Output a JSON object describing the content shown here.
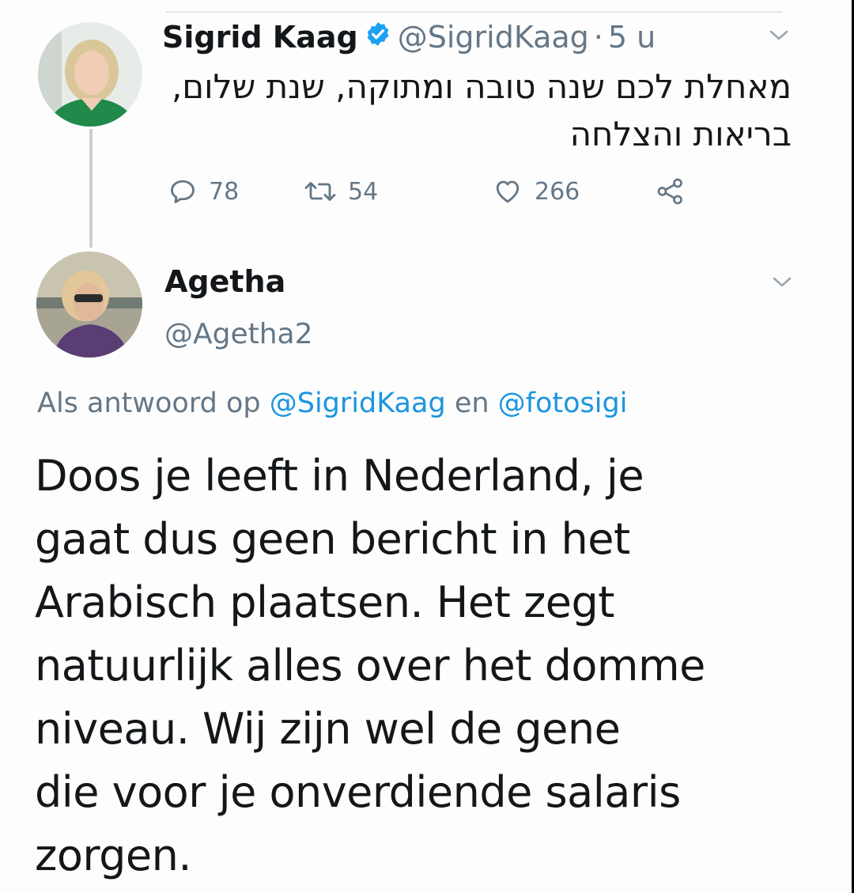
{
  "tweet1": {
    "name": "Sigrid Kaag",
    "handle": "@SigridKaag",
    "separator": "·",
    "time": "5 u",
    "text_line1": "מאחלת לכם שנה טובה ומתוקה, שנת שלום,",
    "text_line2": "בריאות והצלחה",
    "replies": "78",
    "retweets": "54",
    "likes": "266"
  },
  "tweet2": {
    "name": "Agetha",
    "handle": "@Agetha2",
    "reply_prefix": "Als antwoord op",
    "reply_user1": "@SigridKaag",
    "reply_conj": "en",
    "reply_user2": "@fotosigi",
    "lines": [
      "Doos je leeft in Nederland, je",
      "gaat dus geen bericht in het",
      "Arabisch plaatsen. Het zegt",
      "natuurlijk alles over het domme",
      "niveau. Wij zijn wel de gene",
      "die voor je onverdiende salaris",
      "zorgen."
    ]
  },
  "colors": {
    "text": "#14171a",
    "muted": "#657786",
    "link": "#1b95e0",
    "verified": "#1da1f2"
  },
  "icons": [
    "verified-badge-icon",
    "chevron-down-icon",
    "reply-icon",
    "retweet-icon",
    "like-icon",
    "share-icon"
  ]
}
